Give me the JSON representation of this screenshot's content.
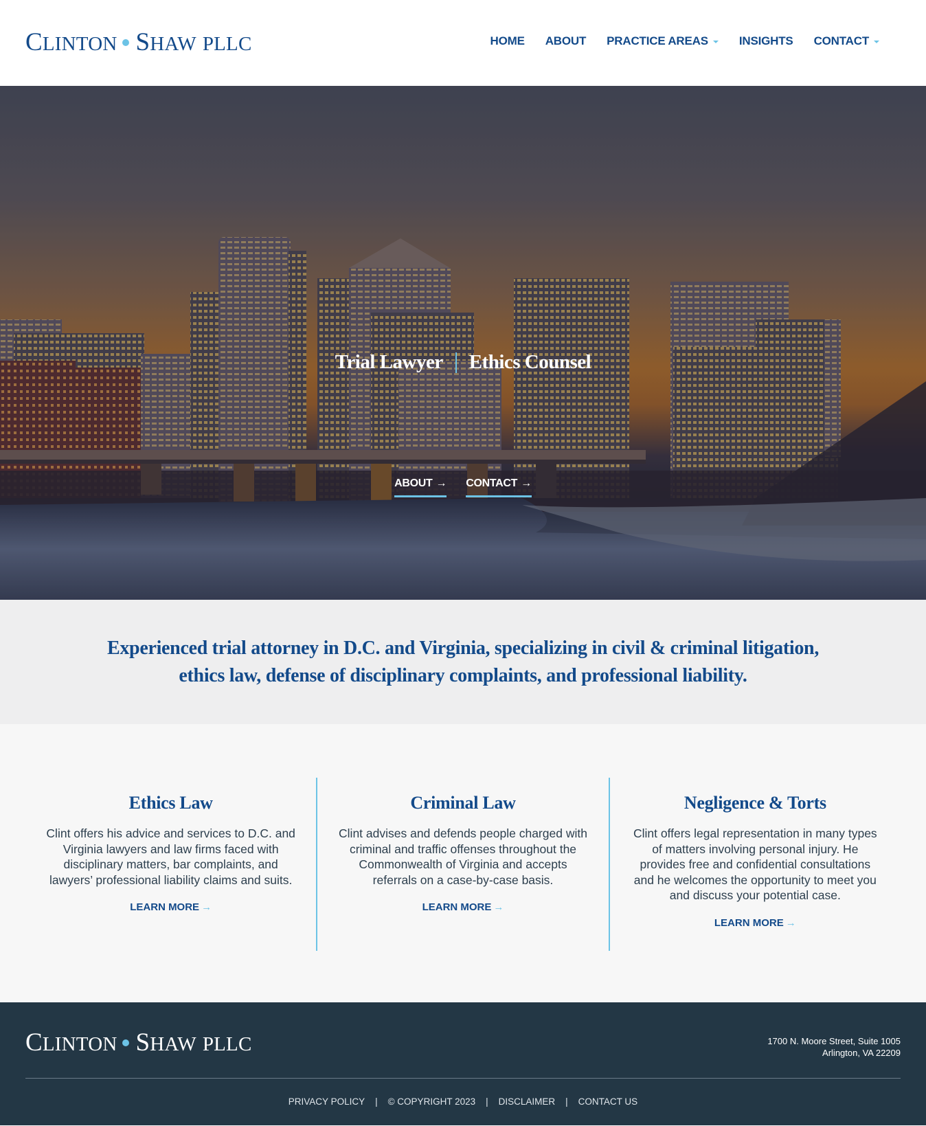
{
  "brand": {
    "name_first_initial": "C",
    "name_first_rest": "LINTON",
    "name_second_initial": "S",
    "name_second_rest": "HAW",
    "name_suffix": "PLLC",
    "accent_color": "#6cc3e6",
    "primary_color": "#134a8a"
  },
  "nav": {
    "items": [
      {
        "label": "HOME",
        "has_dropdown": false
      },
      {
        "label": "ABOUT",
        "has_dropdown": false
      },
      {
        "label": "PRACTICE AREAS",
        "has_dropdown": true
      },
      {
        "label": "INSIGHTS",
        "has_dropdown": false
      },
      {
        "label": "CONTACT",
        "has_dropdown": true
      }
    ]
  },
  "hero": {
    "title_left": "Trial Lawyer",
    "title_right": "Ethics Counsel",
    "ctas": [
      {
        "label": "ABOUT",
        "arrow": "→"
      },
      {
        "label": "CONTACT",
        "arrow": "→"
      }
    ]
  },
  "intro": {
    "text": "Experienced trial attorney in D.C. and Virginia, specializing in civil & criminal litigation, ethics law, defense of disciplinary complaints, and professional liability."
  },
  "practice_areas": [
    {
      "title": "Ethics Law",
      "description": "Clint offers his advice and services to D.C. and Virginia lawyers and law firms faced with disciplinary matters, bar complaints, and lawyers’ professional liability claims and suits.",
      "link_label": "LEARN MORE",
      "arrow": "→"
    },
    {
      "title": "Criminal Law",
      "description": "Clint advises and defends people charged with criminal and traffic offenses throughout the Commonwealth of Virginia and accepts referrals on a case-by-case basis.",
      "link_label": "LEARN MORE",
      "arrow": "→"
    },
    {
      "title": "Negligence & Torts",
      "description": "Clint offers legal representation in many types of matters involving personal injury. He provides free and confidential consultations and he welcomes the opportunity to meet you and discuss your potential case.",
      "link_label": "LEARN MORE",
      "arrow": "→"
    }
  ],
  "footer": {
    "address_line1": "1700 N. Moore Street, Suite 1005",
    "address_line2": "Arlington, VA 22209",
    "links": [
      {
        "label": "PRIVACY POLICY"
      },
      {
        "label": "© COPYRIGHT 2023"
      },
      {
        "label": "DISCLAIMER"
      },
      {
        "label": "CONTACT US"
      }
    ],
    "separator": "|"
  }
}
